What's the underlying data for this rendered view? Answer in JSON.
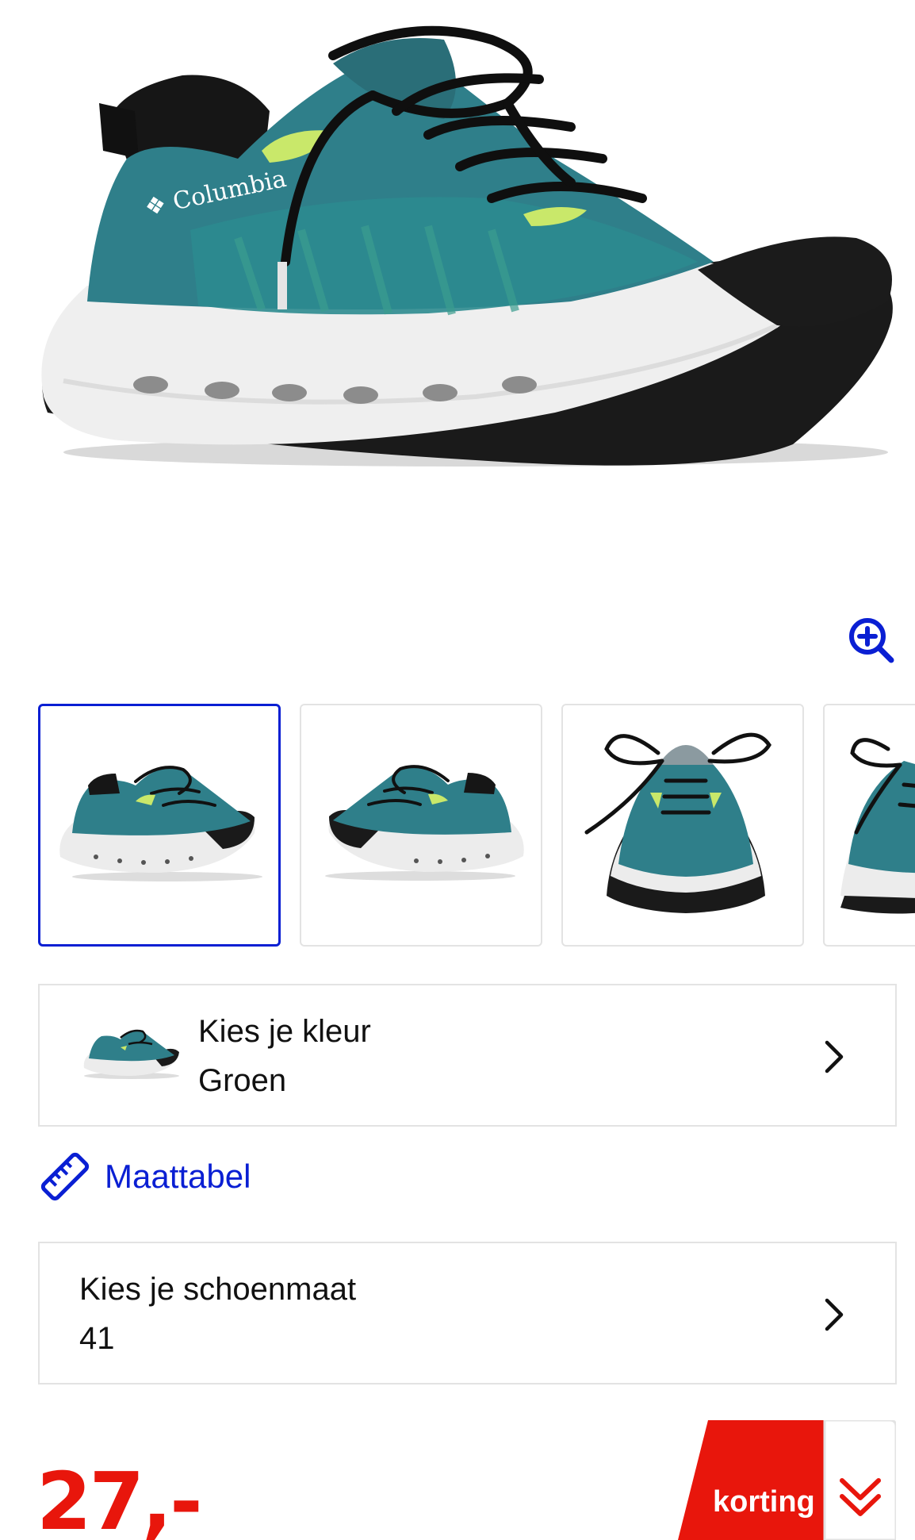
{
  "product": {
    "brand_logo_text": "Columbia"
  },
  "gallery": {
    "zoom_icon": "zoom-in-icon",
    "thumbnails": [
      {
        "view": "side-right",
        "active": true
      },
      {
        "view": "side-left",
        "active": false
      },
      {
        "view": "front",
        "active": false
      },
      {
        "view": "front-angle",
        "active": false
      }
    ]
  },
  "color_selector": {
    "label": "Kies je kleur",
    "value": "Groen",
    "chevron_icon": "chevron-right-icon"
  },
  "size_chart": {
    "label": "Maattabel",
    "icon": "ruler-icon"
  },
  "size_selector": {
    "label": "Kies je schoenmaat",
    "value": "41",
    "chevron_icon": "chevron-right-icon"
  },
  "price": {
    "amount": "27,-"
  },
  "discount": {
    "label": "korting",
    "icon": "double-chevron-down-icon"
  },
  "colors": {
    "accent_blue": "#0a1fd3",
    "sale_red": "#e8160c",
    "shoe_teal": "#2f7f8a",
    "border_grey": "#e3e3e3"
  }
}
